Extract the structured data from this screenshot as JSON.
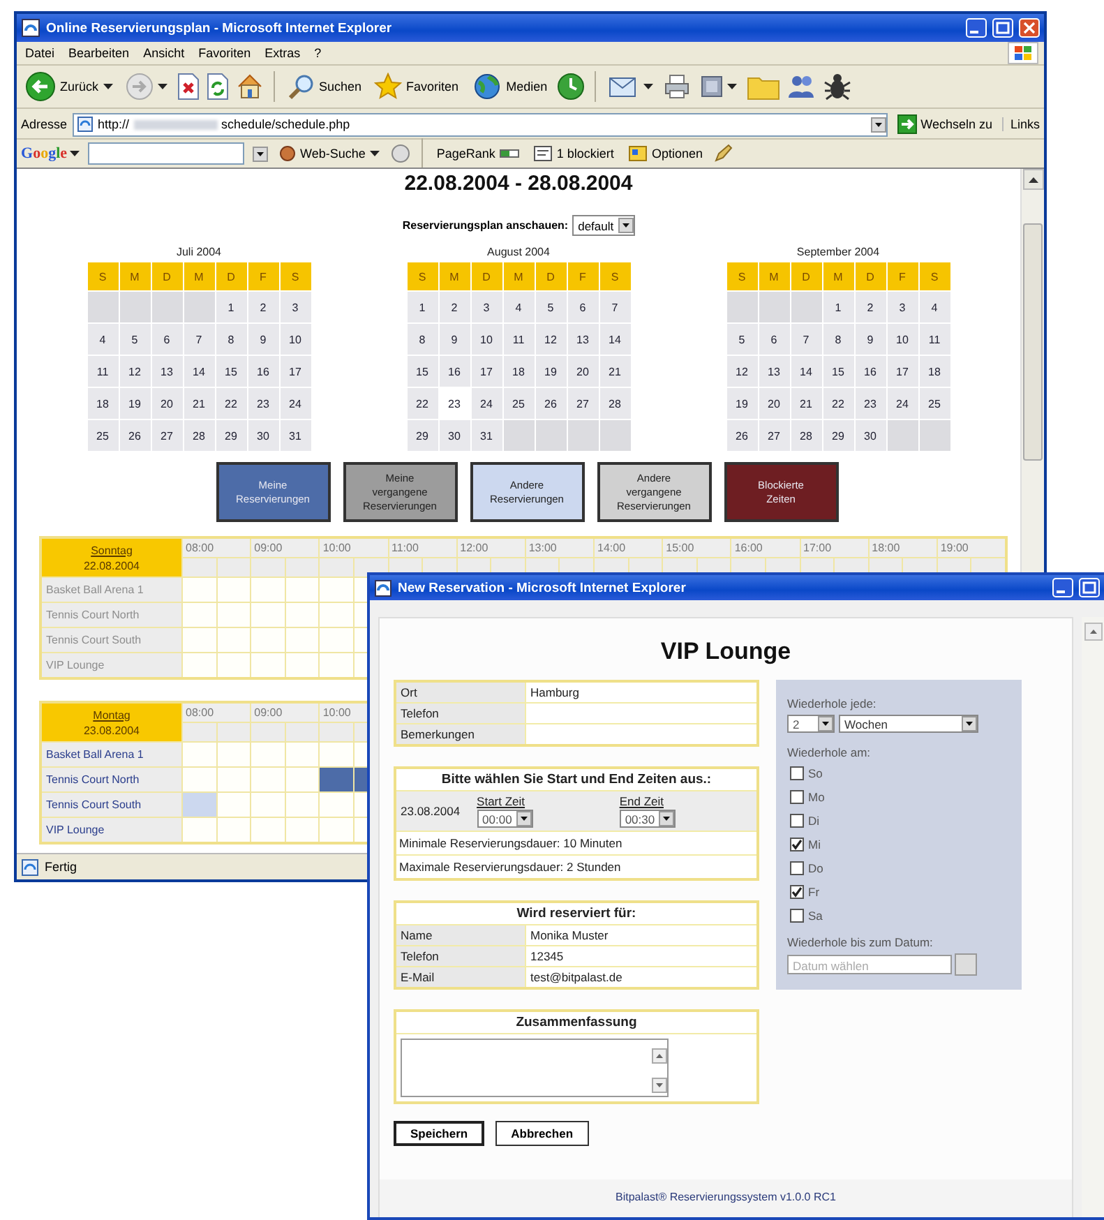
{
  "browser": {
    "title": "Online Reservierungsplan - Microsoft Internet Explorer",
    "menu": [
      "Datei",
      "Bearbeiten",
      "Ansicht",
      "Favoriten",
      "Extras",
      "?"
    ],
    "toolbar": {
      "back": "Zurück",
      "search": "Suchen",
      "favorites": "Favoriten",
      "media": "Medien"
    },
    "address": {
      "label": "Adresse",
      "url_start": "http://",
      "url_end": "schedule/schedule.php",
      "go": "Wechseln zu",
      "links": "Links"
    },
    "google_bar": {
      "logo": "Google",
      "web_search": "Web-Suche",
      "pagerank": "PageRank",
      "popups": "1 blockiert",
      "options": "Optionen"
    },
    "status": "Fertig"
  },
  "page": {
    "week": "22.08.2004 - 28.08.2004",
    "view_label": "Reservierungsplan anschauen:",
    "view_value": "default",
    "calendars": [
      {
        "title": "Juli 2004",
        "weekdays": [
          "S",
          "M",
          "D",
          "M",
          "D",
          "F",
          "S"
        ],
        "weeks": [
          [
            {
              "kind": "empty"
            },
            {
              "kind": "empty"
            },
            {
              "kind": "empty"
            },
            {
              "kind": "empty"
            },
            "1",
            "2",
            "3"
          ],
          [
            "4",
            "5",
            "6",
            "7",
            "8",
            "9",
            "10"
          ],
          [
            "11",
            "12",
            "13",
            "14",
            "15",
            "16",
            "17"
          ],
          [
            "18",
            "19",
            "20",
            "21",
            "22",
            "23",
            "24"
          ],
          [
            "25",
            "26",
            "27",
            "28",
            "29",
            "30",
            "31"
          ]
        ]
      },
      {
        "title": "August 2004",
        "weekdays": [
          "S",
          "M",
          "D",
          "M",
          "D",
          "F",
          "S"
        ],
        "weeks": [
          [
            "1",
            "2",
            "3",
            "4",
            "5",
            "6",
            "7"
          ],
          [
            "8",
            "9",
            "10",
            "11",
            "12",
            "13",
            "14"
          ],
          [
            "15",
            "16",
            "17",
            "18",
            "19",
            "20",
            "21"
          ],
          [
            "22",
            {
              "day": "23",
              "selected": true
            },
            "24",
            "25",
            "26",
            "27",
            "28"
          ],
          [
            "29",
            "30",
            "31",
            {
              "kind": "empty"
            },
            {
              "kind": "empty"
            },
            {
              "kind": "empty"
            },
            {
              "kind": "empty"
            }
          ]
        ]
      },
      {
        "title": "September 2004",
        "weekdays": [
          "S",
          "M",
          "D",
          "M",
          "D",
          "F",
          "S"
        ],
        "weeks": [
          [
            {
              "kind": "empty"
            },
            {
              "kind": "empty"
            },
            {
              "kind": "empty"
            },
            "1",
            "2",
            "3",
            "4"
          ],
          [
            "5",
            "6",
            "7",
            "8",
            "9",
            "10",
            "11"
          ],
          [
            "12",
            "13",
            "14",
            "15",
            "16",
            "17",
            "18"
          ],
          [
            "19",
            "20",
            "21",
            "22",
            "23",
            "24",
            "25"
          ],
          [
            "26",
            "27",
            "28",
            "29",
            "30",
            {
              "kind": "empty"
            },
            {
              "kind": "empty"
            }
          ]
        ]
      }
    ],
    "legend": [
      {
        "lines": [
          "Meine",
          "Reservierungen"
        ],
        "color": "#4d6ca8"
      },
      {
        "lines": [
          "Meine",
          "vergangene",
          "Reservierungen"
        ],
        "color": "#9c9c9c"
      },
      {
        "lines": [
          "Andere",
          "Reservierungen"
        ],
        "color": "#ccd8ef"
      },
      {
        "lines": [
          "Andere",
          "vergangene",
          "Reservierungen"
        ],
        "color": "#d0d0d0"
      },
      {
        "lines": [
          "Blockierte",
          "Zeiten"
        ],
        "color": "#6e1e22"
      }
    ],
    "days": [
      {
        "weekday": "Sonntag",
        "date": "22.08.2004",
        "times": [
          "08:00",
          "09:00",
          "10:00",
          "11:00",
          "12:00",
          "13:00",
          "14:00",
          "15:00",
          "16:00",
          "17:00",
          "18:00",
          "19:00"
        ],
        "rows": [
          {
            "name": "Basket Ball Arena 1",
            "disabled": true
          },
          {
            "name": "Tennis Court North",
            "disabled": true
          },
          {
            "name": "Tennis Court South",
            "disabled": true
          },
          {
            "name": "VIP Lounge",
            "disabled": true
          }
        ]
      },
      {
        "weekday": "Montag",
        "date": "23.08.2004",
        "times": [
          "08:00",
          "09:00",
          "10:00"
        ],
        "rows": [
          {
            "name": "Basket Ball Arena 1",
            "disabled": false
          },
          {
            "name": "Tennis Court North",
            "disabled": false,
            "slots": [
              {
                "kind": "free"
              },
              {
                "kind": "free"
              },
              {
                "kind": "free"
              },
              {
                "kind": "free"
              },
              {
                "kind": "mine"
              },
              {
                "kind": "mine"
              }
            ]
          },
          {
            "name": "Tennis Court South",
            "disabled": false,
            "slots": [
              {
                "kind": "other"
              }
            ]
          },
          {
            "name": "VIP Lounge",
            "disabled": false
          }
        ]
      }
    ]
  },
  "popup": {
    "title": "New Reservation - Microsoft Internet Explorer",
    "heading": "VIP Lounge",
    "info": [
      {
        "label": "Ort",
        "value": "Hamburg"
      },
      {
        "label": "Telefon"
      },
      {
        "label": "Bemerkungen"
      }
    ],
    "times": {
      "title": "Bitte wählen Sie Start und End Zeiten aus.:",
      "date": "23.08.2004",
      "start_label": "Start Zeit",
      "start": "00:00",
      "end_label": "End Zeit",
      "end": "00:30",
      "min": "Minimale Reservierungsdauer: 10 Minuten",
      "max": "Maximale Reservierungsdauer: 2 Stunden"
    },
    "reserved_for": {
      "title": "Wird reserviert für:",
      "rows": [
        {
          "label": "Name",
          "value": "Monika Muster"
        },
        {
          "label": "Telefon",
          "value": "12345"
        },
        {
          "label": "E-Mail",
          "value": "test@bitpalast.de"
        }
      ]
    },
    "summary": {
      "title": "Zusammenfassung"
    },
    "buttons": [
      "Speichern",
      "Abbrechen"
    ],
    "repeat": {
      "every_label": "Wiederhole jede:",
      "every": "2",
      "unit": "Wochen",
      "on_label": "Wiederhole am:",
      "days": [
        {
          "label": "So",
          "checked": false
        },
        {
          "label": "Mo",
          "checked": false
        },
        {
          "label": "Di",
          "checked": false
        },
        {
          "label": "Mi",
          "checked": true
        },
        {
          "label": "Do",
          "checked": false
        },
        {
          "label": "Fr",
          "checked": true
        },
        {
          "label": "Sa",
          "checked": false
        }
      ],
      "until_label": "Wiederhole bis zum Datum:",
      "until_placeholder": "Datum wählen"
    },
    "footer": "Bitpalast® Reservierungssystem v1.0.0 RC1"
  }
}
